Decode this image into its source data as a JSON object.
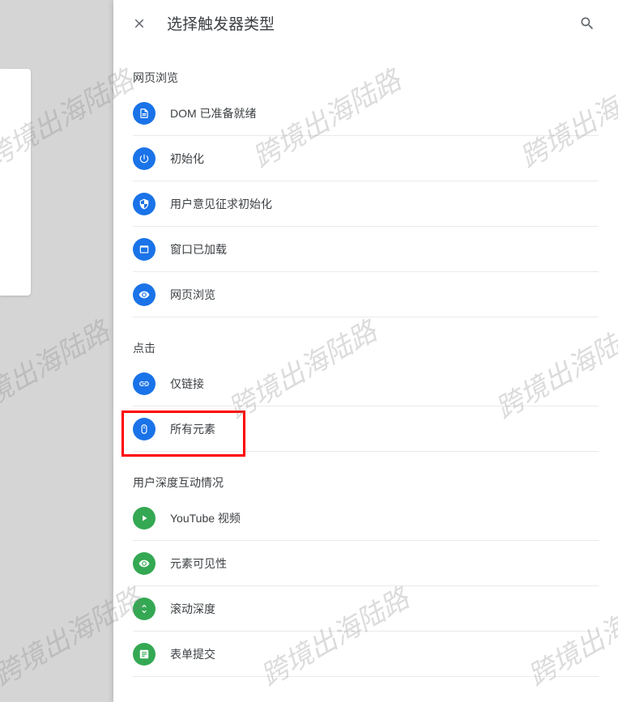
{
  "header": {
    "title": "选择触发器类型"
  },
  "sections": [
    {
      "title": "网页浏览",
      "items": [
        {
          "icon": "page-icon",
          "label": "DOM 已准备就绪",
          "name": "trigger-dom-ready"
        },
        {
          "icon": "power-icon",
          "label": "初始化",
          "name": "trigger-init"
        },
        {
          "icon": "shield-icon",
          "label": "用户意见征求初始化",
          "name": "trigger-consent-init"
        },
        {
          "icon": "window-icon",
          "label": "窗口已加载",
          "name": "trigger-window-loaded"
        },
        {
          "icon": "eye-icon",
          "label": "网页浏览",
          "name": "trigger-pageview"
        }
      ]
    },
    {
      "title": "点击",
      "items": [
        {
          "icon": "link-icon",
          "label": "仅链接",
          "name": "trigger-links-only"
        },
        {
          "icon": "mouse-icon",
          "label": "所有元素",
          "name": "trigger-all-elements"
        }
      ]
    },
    {
      "title": "用户深度互动情况",
      "items": [
        {
          "icon": "play-icon",
          "label": "YouTube 视频",
          "name": "trigger-youtube",
          "color": "green"
        },
        {
          "icon": "visibility-icon",
          "label": "元素可见性",
          "name": "trigger-visibility",
          "color": "green"
        },
        {
          "icon": "scroll-icon",
          "label": "滚动深度",
          "name": "trigger-scroll-depth",
          "color": "green"
        },
        {
          "icon": "form-icon",
          "label": "表单提交",
          "name": "trigger-form-submit",
          "color": "green"
        }
      ]
    }
  ],
  "watermark_text": "跨境出海陆路",
  "highlight_item": "trigger-all-elements"
}
